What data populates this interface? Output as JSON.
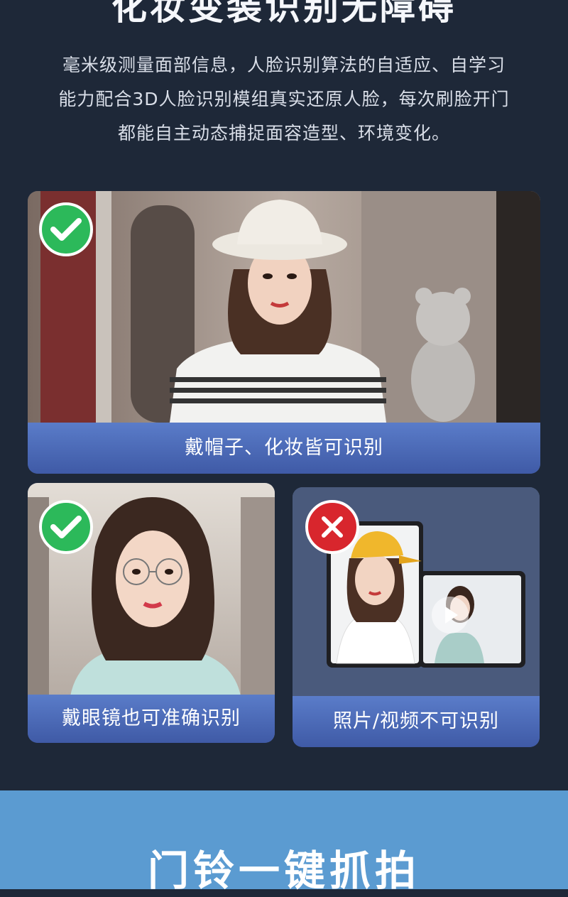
{
  "header": {
    "title": "化妆变装识别无障碍",
    "description_lines": [
      "毫米级测量面部信息，人脸识别算法的自适应、自学习",
      "能力配合3D人脸识别模组真实还原人脸，每次刷脸开门",
      "都能自主动态捕捉面容造型、环境变化。"
    ]
  },
  "cards": {
    "hat": {
      "caption": "戴帽子、化妆皆可识别",
      "status": "recognized"
    },
    "glasses": {
      "caption": "戴眼镜也可准确识别",
      "status": "recognized"
    },
    "photo": {
      "caption": "照片/视频不可识别",
      "status": "not-recognized"
    }
  },
  "next_section": {
    "title": "门铃一键抓拍"
  },
  "colors": {
    "background": "#1e2838",
    "caption_bar": "#4a67b5",
    "ok_badge": "#2cb95a",
    "no_badge": "#d8262d",
    "bottom_band": "#5b9bd1"
  }
}
